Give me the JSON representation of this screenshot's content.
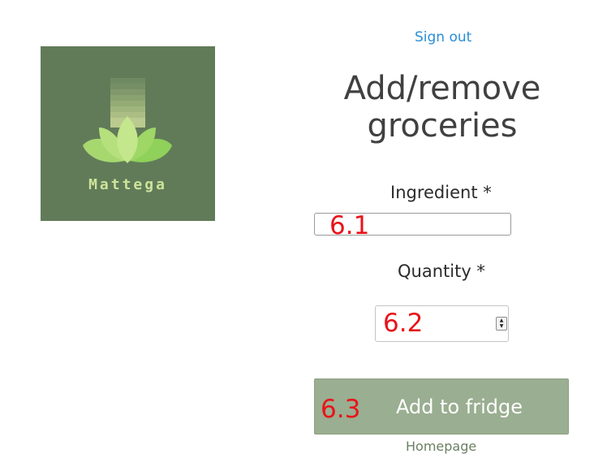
{
  "brand": {
    "logo_text": "Mattega",
    "logo_bg": "#617b59"
  },
  "header": {
    "sign_out": "Sign out"
  },
  "page": {
    "title_line1": "Add/remove",
    "title_line2": "groceries"
  },
  "form": {
    "ingredient_label": "Ingredient *",
    "ingredient_value": "",
    "quantity_label": "Quantity *",
    "quantity_value": "",
    "submit_label": "Add to fridge",
    "submit_color": "#9aae91"
  },
  "footer": {
    "homepage_link": "Homepage"
  },
  "annotations": {
    "ingredient_marker": "6.1",
    "quantity_marker": "6.2",
    "submit_marker": "6.3",
    "marker_color": "#e8141a"
  },
  "icons": {
    "logo": "lotus-icon",
    "spinner_up": "chevron-up-icon",
    "spinner_down": "chevron-down-icon"
  }
}
